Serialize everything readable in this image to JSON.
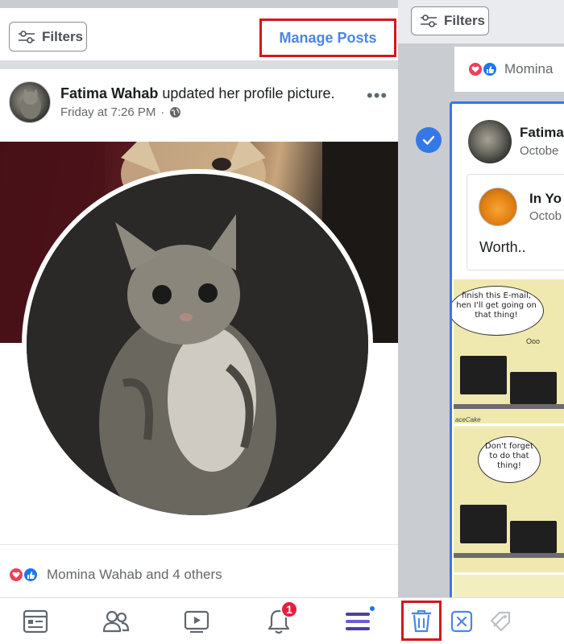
{
  "left": {
    "filters_label": "Filters",
    "manage_posts_label": "Manage Posts",
    "post": {
      "author": "Fatima Wahab",
      "action": " updated her profile picture.",
      "time": "Friday at 7:26 PM",
      "reactions_text": "Momina Wahab and 4 others"
    }
  },
  "right": {
    "filters_label": "Filters",
    "reactions_text": "Momina",
    "card": {
      "author": "Fatima",
      "date": "Octobe",
      "shared_name": "In Yo",
      "shared_date": "Octob",
      "shared_text": "Worth..",
      "comic": {
        "bubble1": "finish this E-mail, hen I'll get going on that thing!",
        "bubble1_tail": "Ooo",
        "credit": "aceCake",
        "bubble2": "Don't forget to do that thing!"
      }
    }
  },
  "bottom_nav": {
    "notifications_badge": "1"
  },
  "colors": {
    "accent": "#4a86e3",
    "highlight_box": "#d4161e",
    "selection": "#3578e5",
    "heart": "#f33e58",
    "like": "#1877f2"
  },
  "icons": [
    "filters-icon",
    "globe-icon",
    "more-icon",
    "heart-icon",
    "like-icon",
    "check-icon",
    "news-feed-icon",
    "friends-icon",
    "watch-icon",
    "bell-icon",
    "menu-icon",
    "trash-icon",
    "close-box-icon",
    "tag-icon"
  ]
}
